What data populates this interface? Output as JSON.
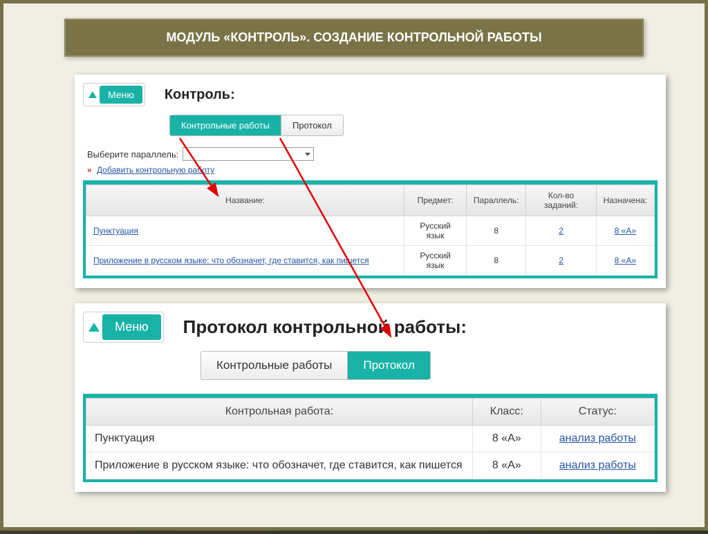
{
  "title": "МОДУЛЬ «КОНТРОЛЬ». СОЗДАНИЕ КОНТРОЛЬНОЙ РАБОТЫ",
  "panel1": {
    "menu": "Меню",
    "heading": "Контроль:",
    "tab_tests": "Контрольные работы",
    "tab_protocol": "Протокол",
    "select_label": "Выберите параллель:",
    "add_link": "Добавить контрольную работу",
    "columns": {
      "name": "Название:",
      "subject": "Предмет:",
      "parallel": "Параллель:",
      "tasks": "Кол-во заданий:",
      "assigned": "Назначена:"
    },
    "rows": [
      {
        "name": "Пунктуация",
        "subject": "Русский язык",
        "parallel": "8",
        "tasks": "2",
        "assigned": "8 «А»"
      },
      {
        "name": "Приложение в русском языке: что обозначет, где ставится, как пишется",
        "subject": "Русский язык",
        "parallel": "8",
        "tasks": "2",
        "assigned": "8 «А»"
      }
    ]
  },
  "panel2": {
    "menu": "Меню",
    "heading": "Протокол контрольной работы:",
    "tab_tests": "Контрольные работы",
    "tab_protocol": "Протокол",
    "columns": {
      "work": "Контрольная работа:",
      "class": "Класс:",
      "status": "Статус:"
    },
    "rows": [
      {
        "work": "Пунктуация",
        "class": "8 «А»",
        "status": "анализ работы"
      },
      {
        "work": "Приложение в русском языке: что обозначет, где ставится, как пишется",
        "class": "8 «А»",
        "status": "анализ работы"
      }
    ]
  }
}
